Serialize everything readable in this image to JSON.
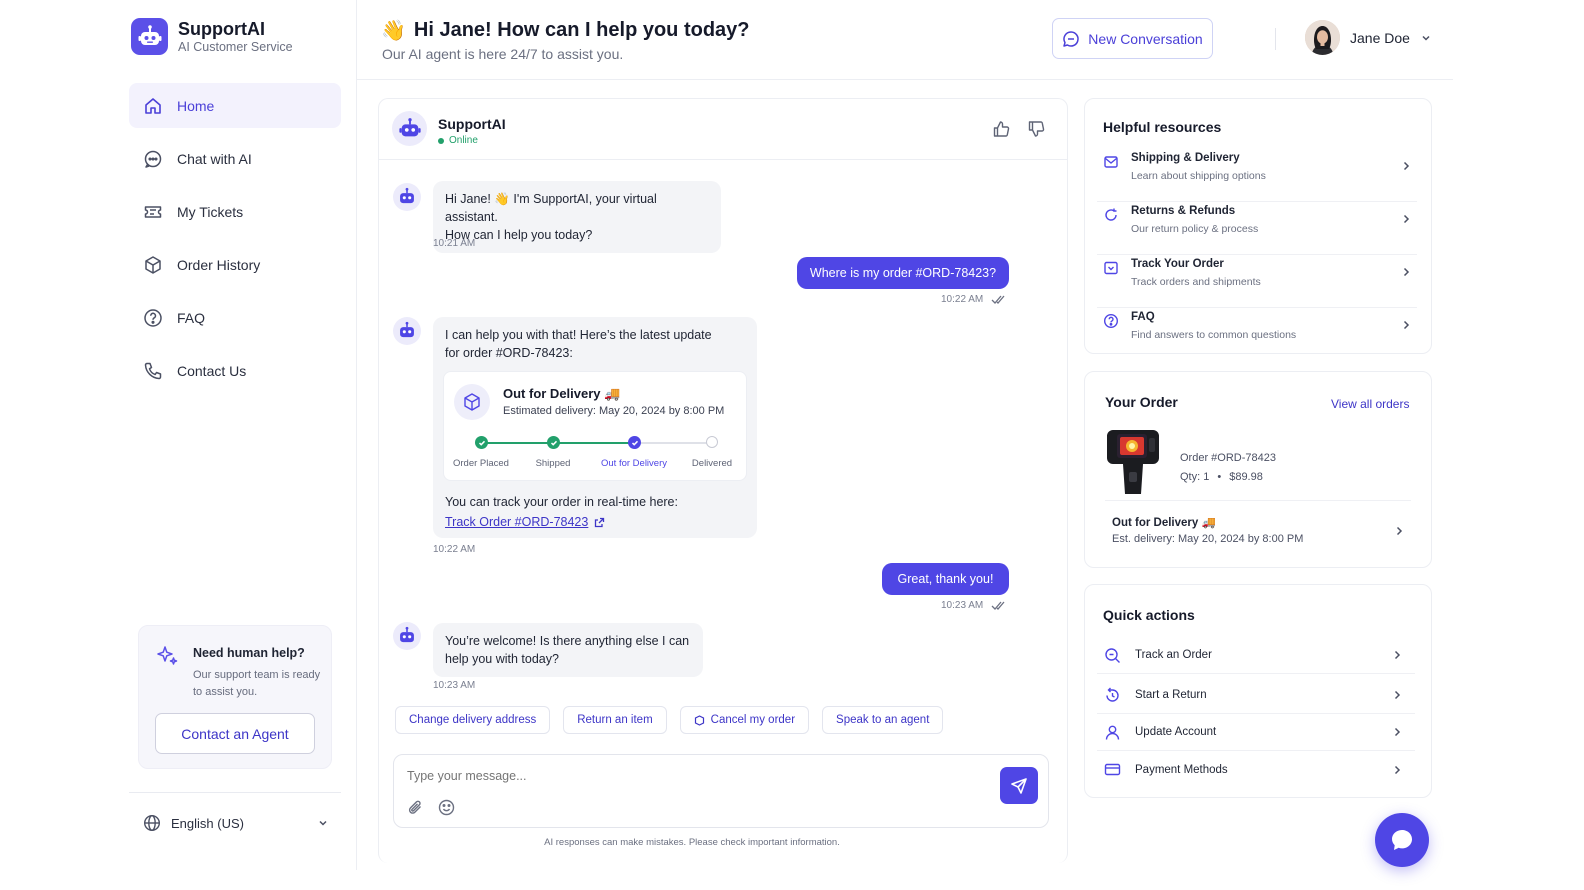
{
  "brand": {
    "name": "SupportAI",
    "subtitle": "AI Customer Service"
  },
  "nav": [
    {
      "label": "Home",
      "icon": "home-icon",
      "active": true
    },
    {
      "label": "Chat with AI",
      "icon": "chat-icon",
      "active": false
    },
    {
      "label": "My Tickets",
      "icon": "ticket-icon",
      "active": false
    },
    {
      "label": "Order History",
      "icon": "box-icon",
      "active": false
    },
    {
      "label": "FAQ",
      "icon": "question-icon",
      "active": false
    },
    {
      "label": "Contact Us",
      "icon": "phone-icon",
      "active": false
    }
  ],
  "help": {
    "title": "Need human help?",
    "text": "Our support team is ready to assist you.",
    "button": "Contact an Agent"
  },
  "language": "English (US)",
  "header": {
    "wave": "👋",
    "greeting": "Hi Jane! How can I help you today?",
    "subtitle": "Our AI agent is here 24/7 to assist you.",
    "new_conversation": "New Conversation",
    "user_name": "Jane Doe"
  },
  "chat": {
    "agent_name": "SupportAI",
    "status": "Online",
    "messages": {
      "m1_line1": "Hi Jane! 👋 I'm SupportAI, your virtual assistant.",
      "m1_line2": "How can I help you today?",
      "m1_time": "10:21 AM",
      "u1": "Where is my order #ORD-78423?",
      "u1_time": "10:22 AM",
      "m2_line1": "I can help you with that! Here’s the latest update",
      "m2_line2": "for order #ORD-78423:",
      "m2_track_text": "You can track your order in real-time here:",
      "m2_link": "Track Order #ORD-78423",
      "m2_time": "10:22 AM",
      "u2": "Great, thank you!",
      "u2_time": "10:23 AM",
      "m3_line1": "You’re welcome! Is there anything else I can",
      "m3_line2": "help you with today?",
      "m3_time": "10:23 AM"
    },
    "delivery": {
      "title": "Out for Delivery",
      "truck": "🚚",
      "estimate": "Estimated delivery: May 20, 2024 by 8:00 PM",
      "steps": [
        "Order Placed",
        "Shipped",
        "Out for Delivery",
        "Delivered"
      ],
      "current_step": 3
    },
    "chips": [
      "Change delivery address",
      "Return an item",
      "Cancel my order",
      "Speak to an agent"
    ],
    "input_placeholder": "Type your message...",
    "disclaimer": "AI responses can make mistakes. Please check important information."
  },
  "resources": {
    "title": "Helpful resources",
    "items": [
      {
        "title": "Shipping & Delivery",
        "sub": "Learn about shipping options",
        "icon": "mail-icon"
      },
      {
        "title": "Returns & Refunds",
        "sub": "Our return policy & process",
        "icon": "refresh-icon"
      },
      {
        "title": "Track Your Order",
        "sub": "Track orders and shipments",
        "icon": "track-icon"
      },
      {
        "title": "FAQ",
        "sub": "Find answers to common questions",
        "icon": "question-icon"
      }
    ]
  },
  "order": {
    "title": "Your Order",
    "view_all": "View all orders",
    "number": "Order #ORD-78423",
    "qty": "Qty: 1",
    "separator": "•",
    "price": "$89.98",
    "status": "Out for Delivery",
    "truck": "🚚",
    "est": "Est. delivery: May 20, 2024 by 8:00 PM"
  },
  "quick_actions": {
    "title": "Quick actions",
    "items": [
      {
        "label": "Track an Order",
        "icon": "search-icon"
      },
      {
        "label": "Start a Return",
        "icon": "return-icon"
      },
      {
        "label": "Update Account",
        "icon": "user-icon"
      },
      {
        "label": "Payment Methods",
        "icon": "card-icon"
      }
    ]
  },
  "colors": {
    "accent": "#4f46e5",
    "success": "#22a06b",
    "active_nav_bg": "#f3f2fd"
  }
}
